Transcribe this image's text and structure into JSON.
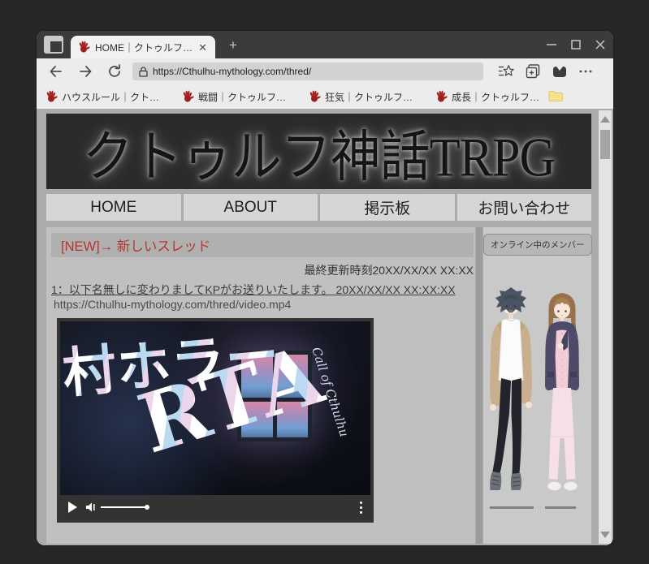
{
  "chrome": {
    "tab": {
      "title": "HOME｜クトゥルフ…"
    },
    "new_tab_label": "+",
    "url": "https://Cthulhu-mythology.com/thred/",
    "bookmarks": [
      {
        "label": "ハウスルール｜クト…"
      },
      {
        "label": "戦闘｜クトゥルフ…"
      },
      {
        "label": "狂気｜クトゥルフ…"
      },
      {
        "label": "成長｜クトゥルフ…"
      }
    ]
  },
  "page": {
    "site_title": "クトゥルフ神話TRPG",
    "nav": [
      {
        "label": "HOME"
      },
      {
        "label": "ABOUT"
      },
      {
        "label": "掲示板"
      },
      {
        "label": "お問い合わせ"
      }
    ],
    "thread": {
      "new_link": "[NEW]→ 新しいスレッド",
      "last_update": "最終更新時刻20XX/XX/XX XX:XX",
      "post": "1：以下名無しに変わりましてKPがお送りいたします。 20XX/XX/XX XX:XX:XX",
      "video_url": "https://Cthulhu-mythology.com/thred/video.mp4"
    },
    "video": {
      "title_line1": "村ホラー",
      "title_line2": "RTA",
      "overlay_caption": "Call of Cthulhu"
    },
    "sidebar": {
      "online_members_label": "オンライン中のメンバー"
    }
  },
  "colors": {
    "hand_red": "#9e1d1d",
    "new_link_red": "#b5352e",
    "folder_yellow": "#f5e38a",
    "banner_bg": "#2b2b2b"
  }
}
